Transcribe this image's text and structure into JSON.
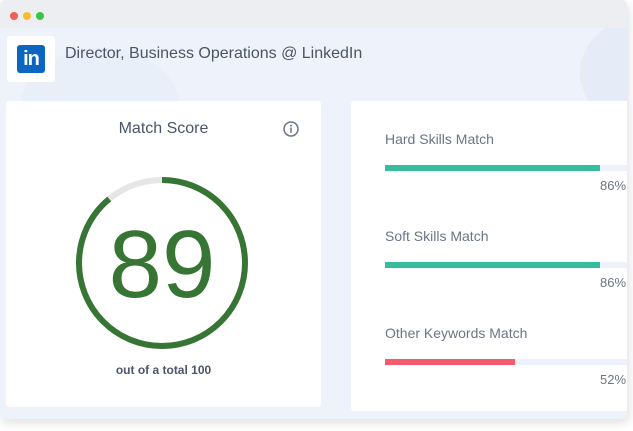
{
  "window": {
    "controls": [
      "close",
      "minimize",
      "zoom"
    ]
  },
  "header": {
    "logo_text": "in",
    "logo_icon": "linkedin-logo-icon",
    "job_title": "Director, Business Operations @ LinkedIn"
  },
  "match_score": {
    "title": "Match Score",
    "info_icon": "info-icon",
    "value": "89",
    "score_fraction": 0.89,
    "caption": "out of a total 100",
    "colors": {
      "ring": "#367534",
      "track": "#e6e6e6",
      "text": "#367534"
    }
  },
  "skills": [
    {
      "label": "Hard Skills Match",
      "percent_text": "86%",
      "percent": 86,
      "color": "#34bc9c"
    },
    {
      "label": "Soft Skills Match",
      "percent_text": "86%",
      "percent": 86,
      "color": "#34bc9c"
    },
    {
      "label": "Other Keywords Match",
      "percent_text": "52%",
      "percent": 52,
      "color": "#f55b6e"
    }
  ]
}
